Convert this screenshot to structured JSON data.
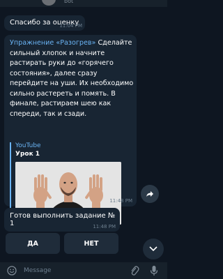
{
  "header": {
    "bot_label": "bot"
  },
  "messages": [
    {
      "text": "Спасибо за оценку",
      "time": "11:04 PM"
    },
    {
      "link": "Упражнение «Разогрев»",
      "text": " Сделайте сильный хлопок и начните растирать руки до «горячего состояния», далее сразу перейдите на уши. Их необходимо сильно растереть и помять. В финале, растираем шею как спереди, так и сзади.",
      "preview": {
        "site": "YouTube",
        "title": "Урок 1"
      },
      "time": "11:48 PM"
    },
    {
      "text": "Готов выполнить задание № 1",
      "time": "11:48 PM"
    }
  ],
  "keyboard": {
    "yes": "ДА",
    "no": "НЕТ"
  },
  "input": {
    "placeholder": "Message"
  },
  "icons": {
    "share": "share-icon",
    "scroll_down": "chevron-down-icon",
    "emoji": "smile-icon",
    "attach": "paperclip-icon",
    "mic": "microphone-icon"
  },
  "colors": {
    "background": "#0e1621",
    "bubble": "#182533",
    "link": "#6ab3f3",
    "time": "#6d7f8f"
  }
}
